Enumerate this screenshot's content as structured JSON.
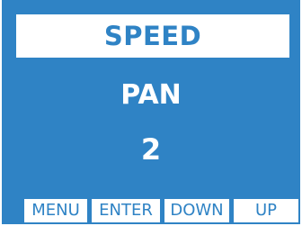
{
  "display": {
    "title": "SPEED",
    "mode": "PAN",
    "value": "2"
  },
  "softkeys": [
    {
      "label": "MENU"
    },
    {
      "label": "ENTER"
    },
    {
      "label": "DOWN"
    },
    {
      "label": "UP"
    }
  ],
  "colors": {
    "background": "#2f83c5",
    "panel": "#ffffff",
    "text_on_background": "#ffffff",
    "text_on_panel": "#2f83c5"
  }
}
